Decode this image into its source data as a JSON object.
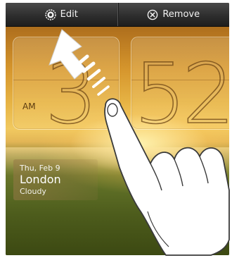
{
  "action_bar": {
    "edit_label": "Edit",
    "edit_icon": "gear-icon",
    "remove_label": "Remove",
    "remove_icon": "circle-x-icon"
  },
  "clock": {
    "hour": "3",
    "minutes": "52",
    "period": "AM"
  },
  "weather": {
    "date": "Thu, Feb 9",
    "city": "London",
    "condition": "Cloudy"
  },
  "colors": {
    "bar": "#2e2e2e",
    "text": "#ffffff",
    "sky": "#e7b445",
    "meadow": "#5d6d25"
  }
}
